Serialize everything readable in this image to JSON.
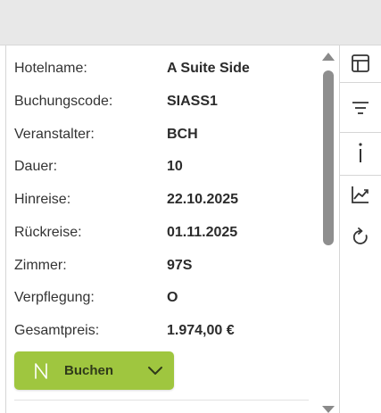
{
  "details": {
    "hotel_label": "Hotelname:",
    "hotel_value": "A Suite Side",
    "code_label": "Buchungscode:",
    "code_value": "SIASS1",
    "operator_label": "Veranstalter:",
    "operator_value": "BCH",
    "duration_label": "Dauer:",
    "duration_value": "10",
    "outbound_label": "Hinreise:",
    "outbound_value": "22.10.2025",
    "return_label": "Rückreise:",
    "return_value": "01.11.2025",
    "room_label": "Zimmer:",
    "room_value": "97S",
    "board_label": "Verpflegung:",
    "board_value": "O",
    "price_label": "Gesamtpreis:",
    "price_value": "1.974,00 €"
  },
  "book_button": {
    "label": "Buchen",
    "icon": "n-icon",
    "dropdown_icon": "chevron-down-icon",
    "color": "#9fc63f"
  },
  "rail_icons": [
    "table-icon",
    "filter-icon",
    "info-icon",
    "chart-icon",
    "refresh-icon"
  ]
}
